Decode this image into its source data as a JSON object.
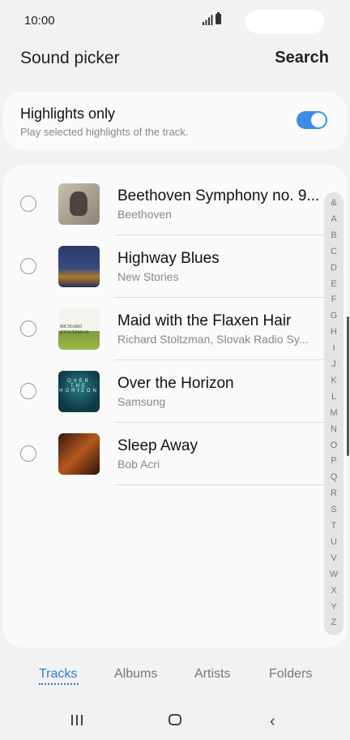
{
  "status": {
    "time": "10:00"
  },
  "header": {
    "title": "Sound picker",
    "search_label": "Search"
  },
  "highlights": {
    "title": "Highlights only",
    "subtitle": "Play selected highlights of the track.",
    "enabled": true
  },
  "tracks": [
    {
      "title": "Beethoven Symphony no. 9...",
      "artist": "Beethoven",
      "selected": false
    },
    {
      "title": "Highway Blues",
      "artist": "New Stories",
      "selected": false
    },
    {
      "title": "Maid with the Flaxen Hair",
      "artist": "Richard Stoltzman, Slovak Radio Sy...",
      "selected": false
    },
    {
      "title": "Over the Horizon",
      "artist": "Samsung",
      "selected": false
    },
    {
      "title": "Sleep Away",
      "artist": "Bob Acri",
      "selected": false
    }
  ],
  "album_art_text": {
    "maid": "RICHARD STOLTZMAN",
    "horizon": "OVER THE HORIZON"
  },
  "index_letters": [
    "&",
    "A",
    "B",
    "C",
    "D",
    "E",
    "F",
    "G",
    "H",
    "I",
    "J",
    "K",
    "L",
    "M",
    "N",
    "O",
    "P",
    "Q",
    "R",
    "S",
    "T",
    "U",
    "V",
    "W",
    "X",
    "Y",
    "Z"
  ],
  "tabs": [
    {
      "label": "Tracks",
      "active": true
    },
    {
      "label": "Albums",
      "active": false
    },
    {
      "label": "Artists",
      "active": false
    },
    {
      "label": "Folders",
      "active": false
    }
  ],
  "colors": {
    "accent": "#2a7ed6",
    "toggle_on": "#3b8ee6"
  }
}
